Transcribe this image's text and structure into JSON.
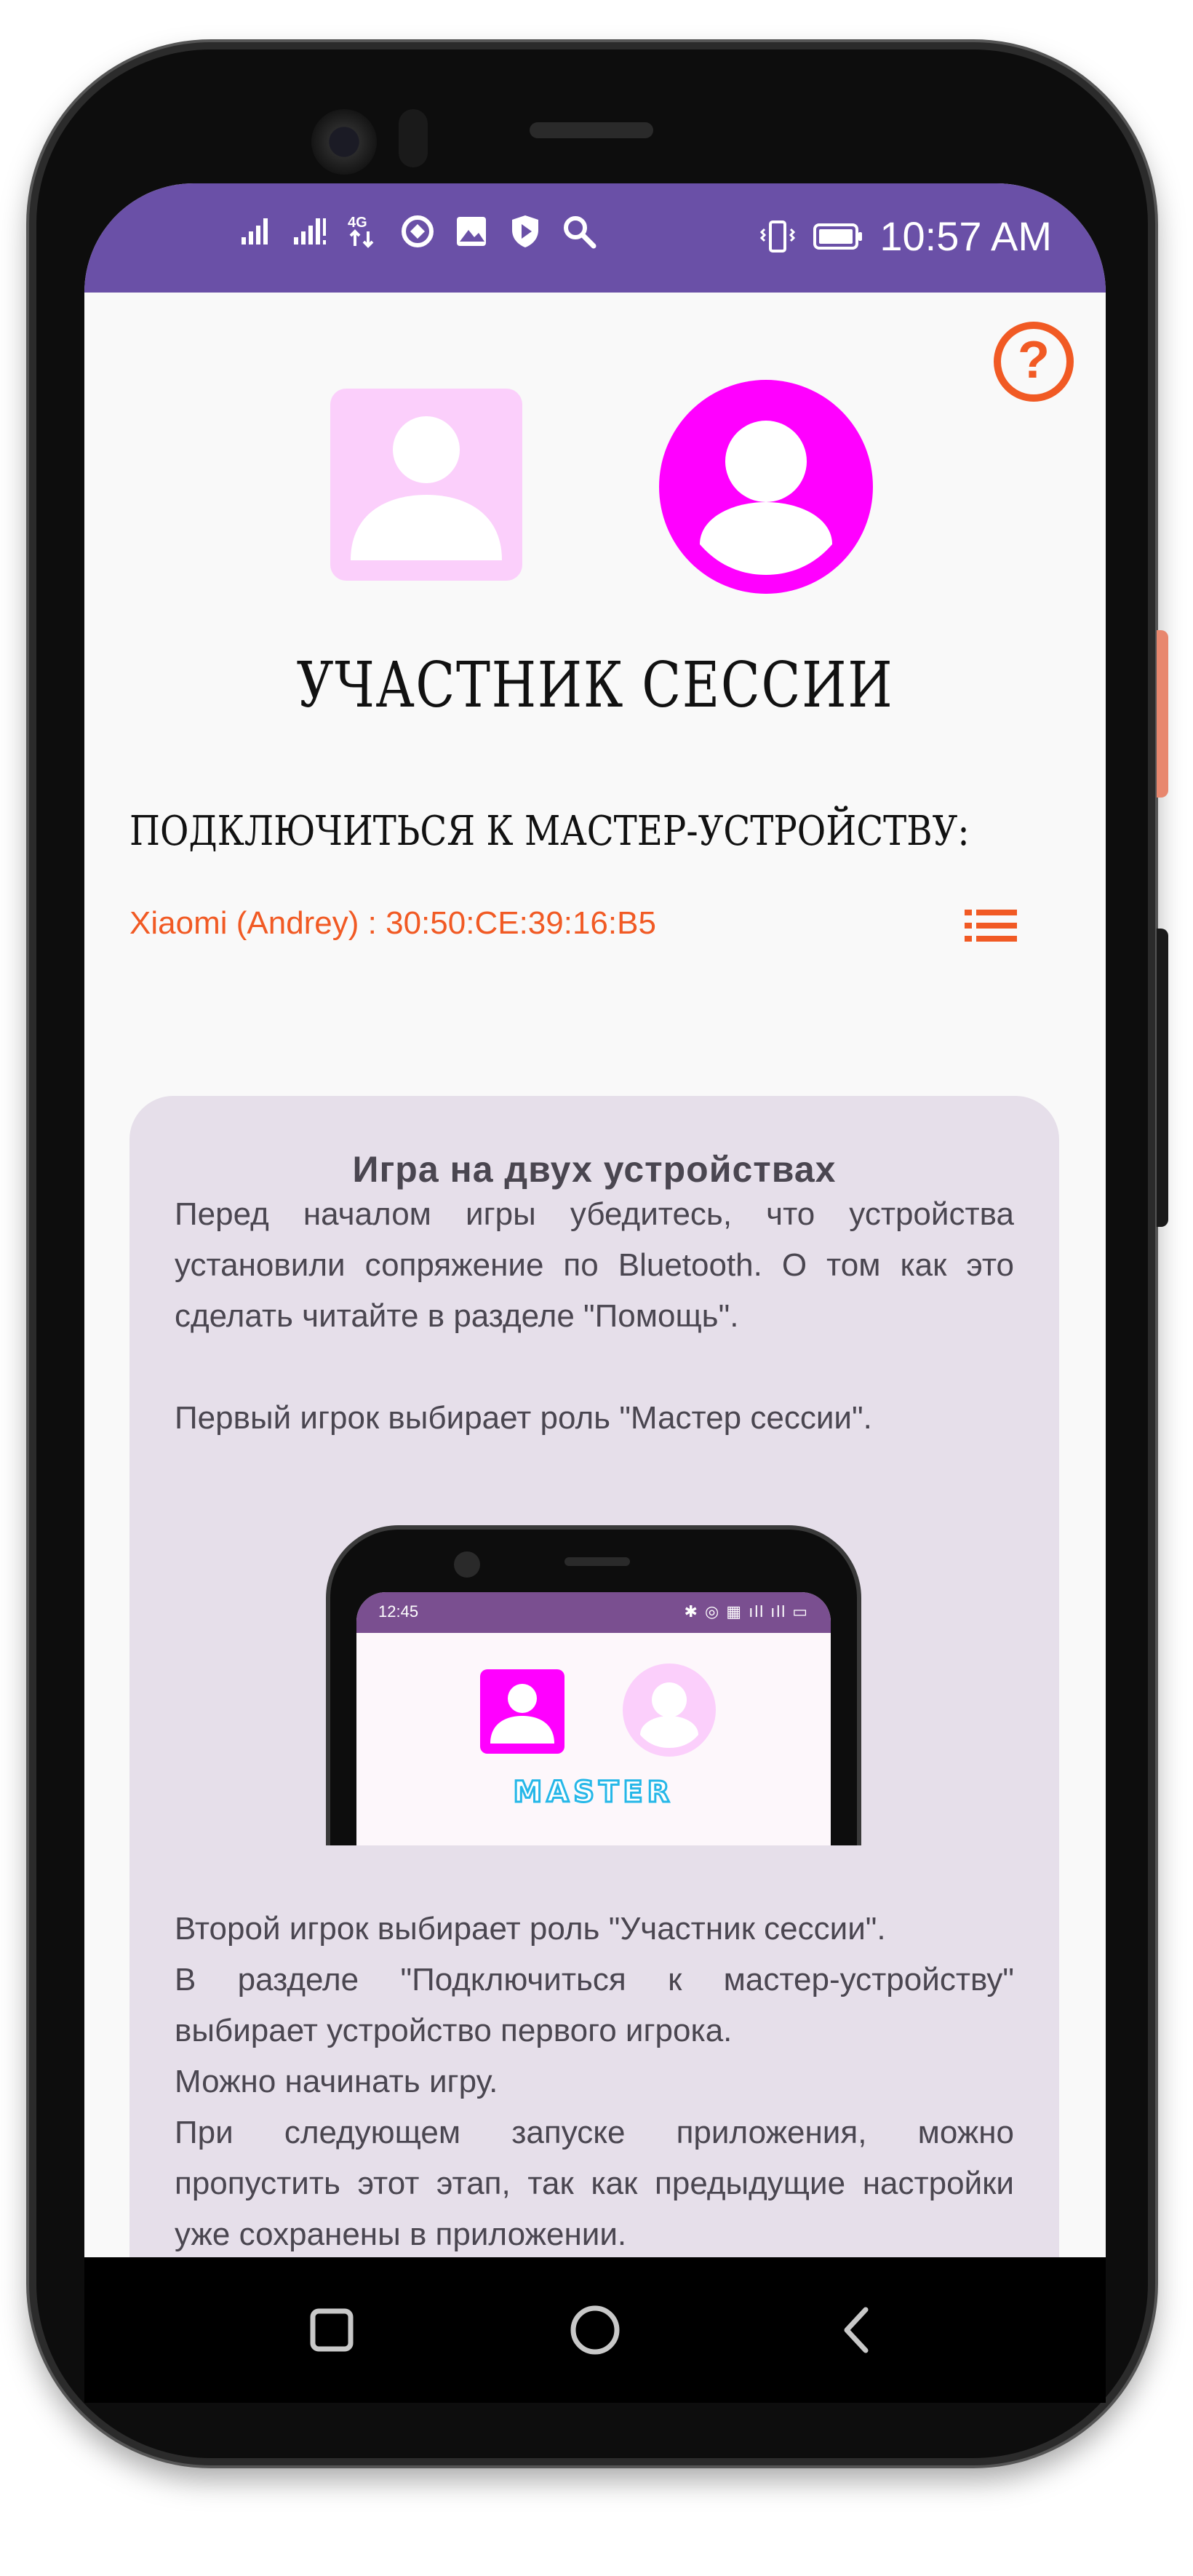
{
  "status_bar": {
    "time": "10:57 AM",
    "network_label": "4G"
  },
  "main": {
    "role_title": "УЧАСТНИК СЕССИИ",
    "connect_heading": "ПОДКЛЮЧИТЬСЯ К МАСТЕР-УСТРОЙСТВУ:",
    "selected_device": "Xiaomi (Andrey) : 30:50:CE:39:16:B5"
  },
  "help_button": {
    "label": "?"
  },
  "info_card": {
    "title": "Игра на двух устройствах",
    "paragraph_1": "Перед началом игры убедитесь, что устройства установили сопряжение по Bluetooth. О том как это сделать читайте в разделе \"Помощь\".",
    "paragraph_2": "Первый игрок выбирает роль \"Мастер сессии\".",
    "paragraph_3_lines": [
      "Второй игрок выбирает роль \"Участник сессии\".",
      "В разделе \"Подключиться к мастер-устройству\" выбирает устройство первого игрока.",
      "Можно начинать игру.",
      "При следующем запуске приложения, можно пропустить этот этап, так как предыдущие настройки уже сохранены в приложении."
    ],
    "illustration": {
      "time": "12:45",
      "label": "MASTER"
    }
  },
  "colors": {
    "status_bar": "#6a50a7",
    "accent_orange": "#f15a24",
    "magenta": "#ff00ff",
    "light_pink": "#fbcffb",
    "card_background": "#e6dfea",
    "screen_background": "#f9f9f9"
  },
  "icons": {
    "status_left": [
      "signal-icon",
      "signal-icon",
      "network-4g-icon",
      "sync-icon",
      "image-icon",
      "shield-icon",
      "search-icon"
    ],
    "status_right": [
      "vibrate-icon",
      "battery-icon"
    ],
    "navigation": [
      "recents-icon",
      "home-icon",
      "back-icon"
    ],
    "list": "list-icon",
    "help": "help-icon"
  }
}
